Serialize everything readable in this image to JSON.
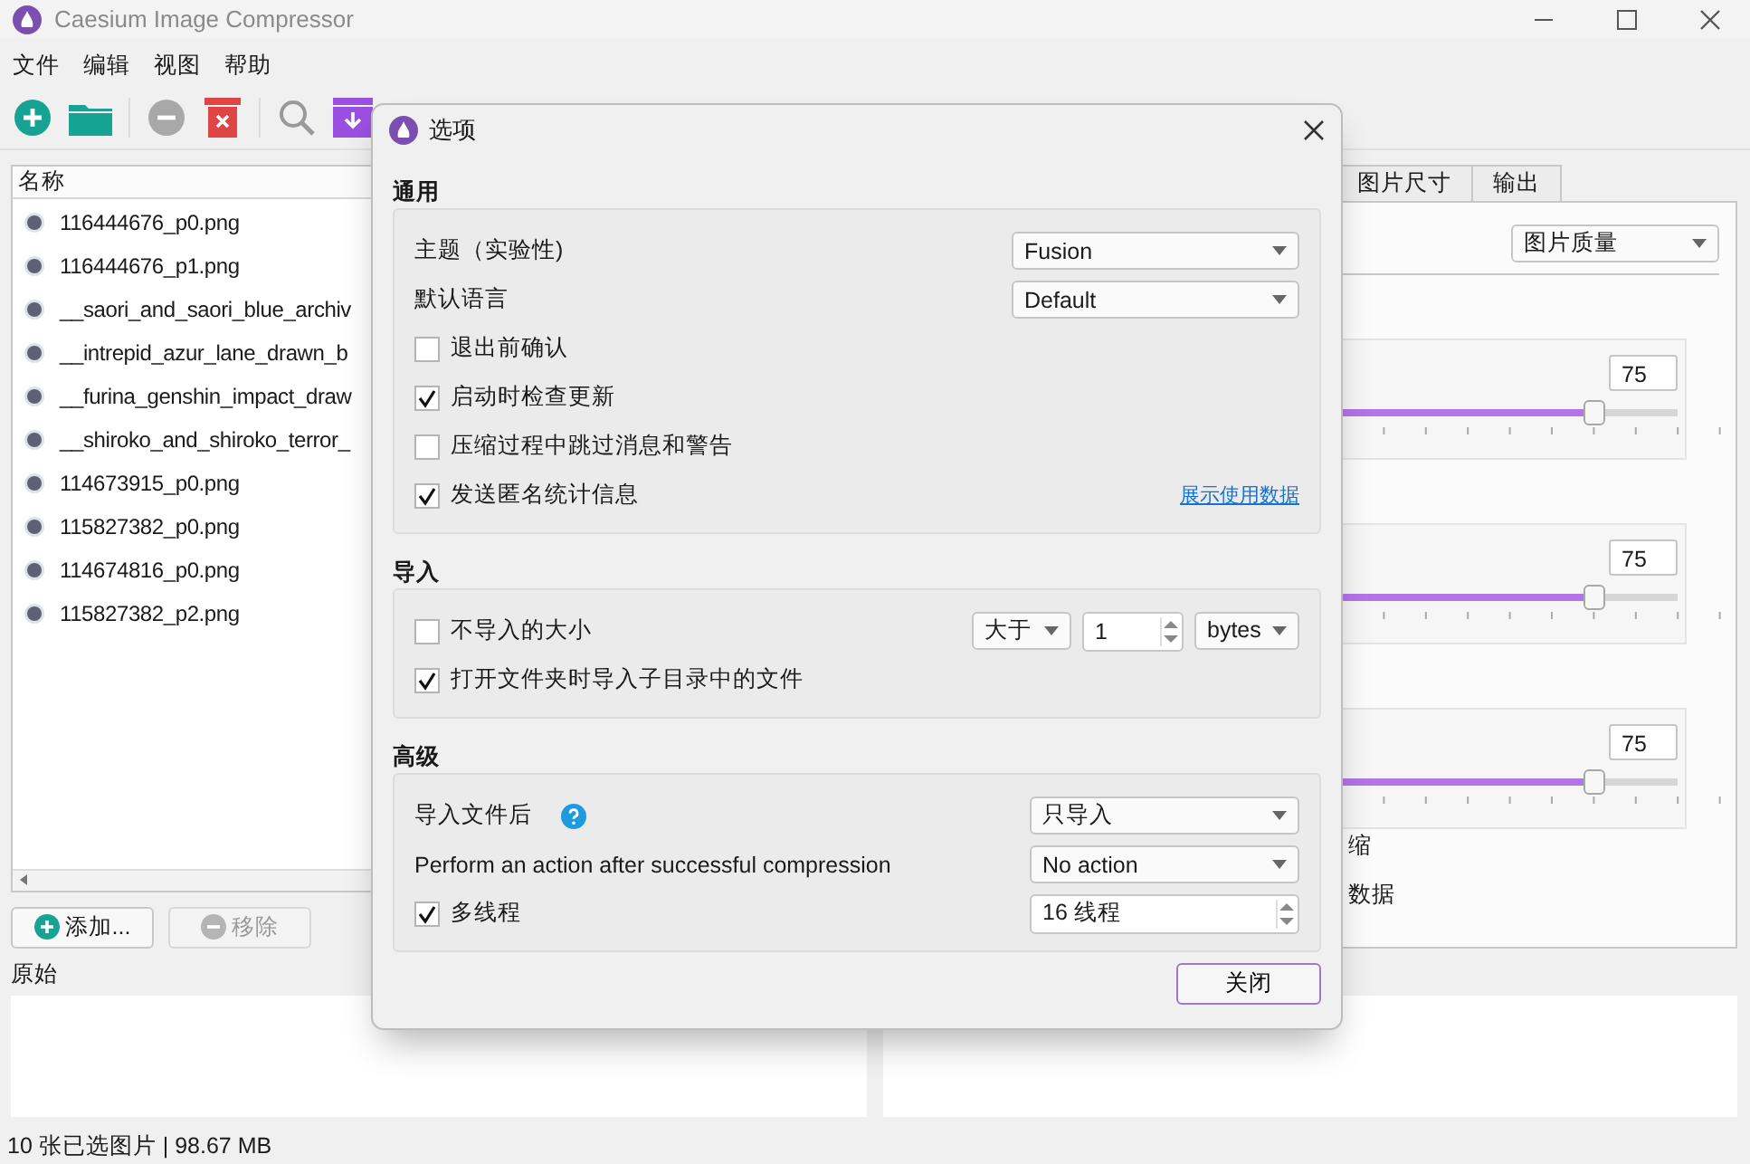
{
  "window": {
    "title": "Caesium Image Compressor"
  },
  "menu": [
    {
      "label": "文件"
    },
    {
      "label": "编辑"
    },
    {
      "label": "视图"
    },
    {
      "label": "帮助"
    }
  ],
  "file_list": {
    "column": "名称",
    "items": [
      {
        "name": "116444676_p0.png"
      },
      {
        "name": "116444676_p1.png"
      },
      {
        "name": "__saori_and_saori_blue_archiv"
      },
      {
        "name": "__intrepid_azur_lane_drawn_b"
      },
      {
        "name": "__furina_genshin_impact_draw"
      },
      {
        "name": "__shiroko_and_shiroko_terror_"
      },
      {
        "name": "114673915_p0.png"
      },
      {
        "name": "115827382_p0.png"
      },
      {
        "name": "114674816_p0.png"
      },
      {
        "name": "115827382_p2.png"
      }
    ]
  },
  "list_buttons": [
    {
      "kind": "add",
      "label": "添加...",
      "disabled": false
    },
    {
      "kind": "remove",
      "label": "移除",
      "disabled": true
    }
  ],
  "preview": {
    "label": "原始"
  },
  "right_tabs": [
    {
      "label": "图片尺寸",
      "selected": false
    },
    {
      "label": "输出",
      "selected": false
    }
  ],
  "quality_mode": "图片质量",
  "sliders": [
    {
      "value": "75",
      "level": 0.75
    },
    {
      "value": "75",
      "level": 0.75
    },
    {
      "value": "75",
      "level": 0.75
    }
  ],
  "partial_options": [
    {
      "label": "缩"
    },
    {
      "label": "数据"
    }
  ],
  "status_bar": "10 张已选图片 | 98.67 MB",
  "dialog": {
    "title": "选项",
    "sections": [
      {
        "title": "通用",
        "rows": [
          {
            "kind": "select",
            "label": "主题（实验性)",
            "value": "Fusion"
          },
          {
            "kind": "select",
            "label": "默认语言",
            "value": "Default"
          },
          {
            "kind": "checkbox",
            "label": "退出前确认",
            "checked": false
          },
          {
            "kind": "checkbox",
            "label": "启动时检查更新",
            "checked": true
          },
          {
            "kind": "checkbox",
            "label": "压缩过程中跳过消息和警告",
            "checked": false
          },
          {
            "kind": "checkbox",
            "label": "发送匿名统计信息",
            "checked": true,
            "link": "展示使用数据"
          }
        ]
      },
      {
        "title": "导入",
        "rows": [
          {
            "kind": "size",
            "label": "不导入的大小",
            "checked": false,
            "comparator": "大于",
            "amount": "1",
            "unit": "bytes"
          },
          {
            "kind": "checkbox",
            "label": "打开文件夹时导入子目录中的文件",
            "checked": true
          }
        ]
      },
      {
        "title": "高级",
        "rows": [
          {
            "kind": "select",
            "label": "导入文件后",
            "value": "只导入",
            "help": true
          },
          {
            "kind": "select",
            "label": "Perform an action after successful compression",
            "value": "No action"
          },
          {
            "kind": "check_spin",
            "label": "多线程",
            "checked": true,
            "value": "16 线程"
          }
        ]
      }
    ],
    "close_button": "关闭"
  }
}
